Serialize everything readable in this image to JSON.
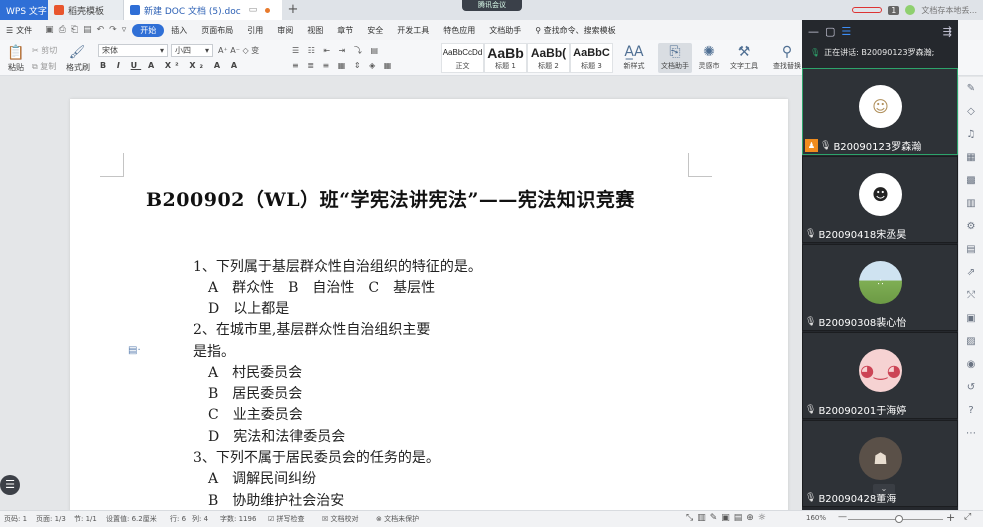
{
  "titlebar": {
    "tabs": [
      {
        "label": "WPS 文字"
      },
      {
        "label": "稻壳模板"
      },
      {
        "label": "新建 DOC 文档 (5).doc"
      }
    ],
    "new_tab": "+",
    "meeting_pill": "腾讯会议",
    "badge_number": "1",
    "cloud_status": "文档存本地丢..."
  },
  "menubar": {
    "file": "文件",
    "items": [
      "开始",
      "插入",
      "页面布局",
      "引用",
      "审阅",
      "视图",
      "章节",
      "安全",
      "开发工具",
      "特色应用",
      "文档助手"
    ],
    "active_index": 0,
    "search": "查找命令、搜索模板"
  },
  "ribbon": {
    "paste": "粘贴",
    "cut": "剪切",
    "copy": "复制",
    "format_painter": "格式刷",
    "font_name": "宋体",
    "font_size": "小四",
    "styles": [
      {
        "sample": "AaBbCcDd",
        "label": "正文"
      },
      {
        "sample": "AaBb",
        "label": "标题 1"
      },
      {
        "sample": "AaBb(",
        "label": "标题 2"
      },
      {
        "sample": "AaBbC",
        "label": "标题 3"
      }
    ],
    "new_style": "新样式",
    "doc_assistant": "文档助手",
    "inspiration": "灵感市",
    "text_tools": "文字工具",
    "find_replace": "查找替换"
  },
  "document": {
    "title": "B200902（WL）班“学宪法讲宪法”——宪法知识竞赛",
    "lines": [
      "1、下列属于基层群众性自治组织的特征的是。",
      "A　群众性　B　自治性　C　基层性",
      "D　以上都是",
      "2、在城市里,基层群众性自治组织主要",
      "是指。",
      "A　村民委员会",
      "B　居民委员会",
      "C　业主委员会",
      "D　宪法和法律委员会",
      "3、下列不属于居民委员会的任务的是。",
      "A　调解民间纠纷",
      "B　协助维护社会治安"
    ]
  },
  "meeting": {
    "speaking": "正在讲话: B20090123罗森瀚;",
    "participants": [
      {
        "name": "B20090123罗森瀚",
        "host": true
      },
      {
        "name": "B20090418宋丞昊",
        "host": false
      },
      {
        "name": "B20090308裴心怡",
        "host": false
      },
      {
        "name": "B20090201于海婷",
        "host": false
      },
      {
        "name": "B20090428董海",
        "host": false
      }
    ]
  },
  "statusbar": {
    "page_num": "页码: 1",
    "pages": "页面: 1/3",
    "section": "节: 1/1",
    "set_value": "设置值: 6.2厘米",
    "row": "行: 6",
    "col": "列: 4",
    "word_count": "字数: 1196",
    "spell_check": "拼写检查",
    "doc_proofread": "文档校对",
    "doc_protect": "文档未保护",
    "zoom": "160%",
    "zoom_level": 0.54
  },
  "colors": {
    "accent": "#2f6fd6",
    "meeting_bg": "#25282d",
    "active_speaker": "#2da36b",
    "host_badge": "#f08c1e"
  }
}
